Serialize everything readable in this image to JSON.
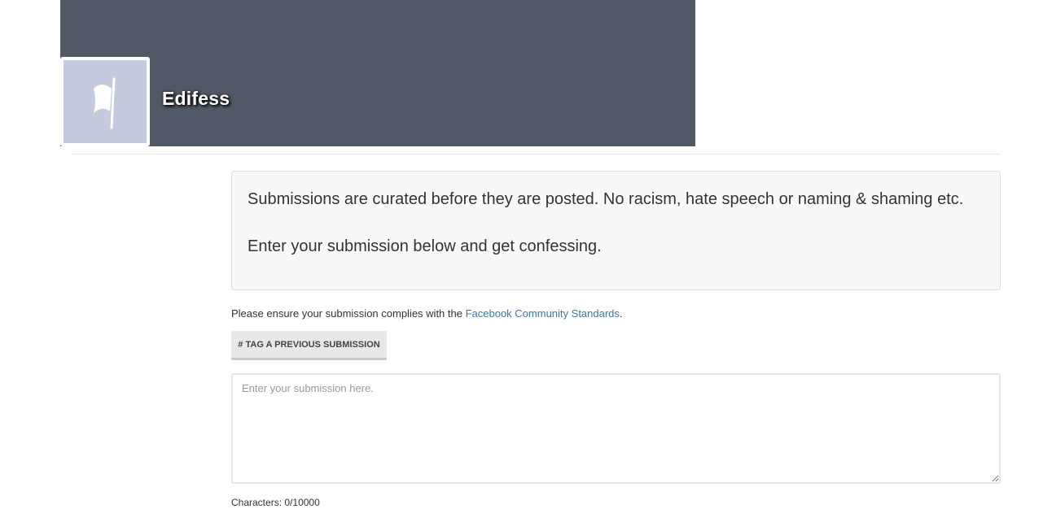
{
  "header": {
    "page_name": "Edifess",
    "avatar_icon": "flag-icon",
    "cover_color": "#515866",
    "avatar_color": "#c5cadf"
  },
  "notice": {
    "line1": "Submissions are curated before they are posted. No racism, hate speech or naming & shaming etc.",
    "line2": "Enter your submission below and get confessing."
  },
  "compliance": {
    "prefix": "Please ensure your submission complies with the ",
    "link_text": "Facebook Community Standards",
    "suffix": "."
  },
  "tag_button": {
    "label": "# Tag a previous submission"
  },
  "submission_input": {
    "value": "",
    "placeholder": "Enter your submission here."
  },
  "character_counter": {
    "label": "Characters: ",
    "count": "0",
    "separator": "/",
    "max": "10000"
  },
  "colors": {
    "link": "#337ab7",
    "text": "#333333"
  }
}
